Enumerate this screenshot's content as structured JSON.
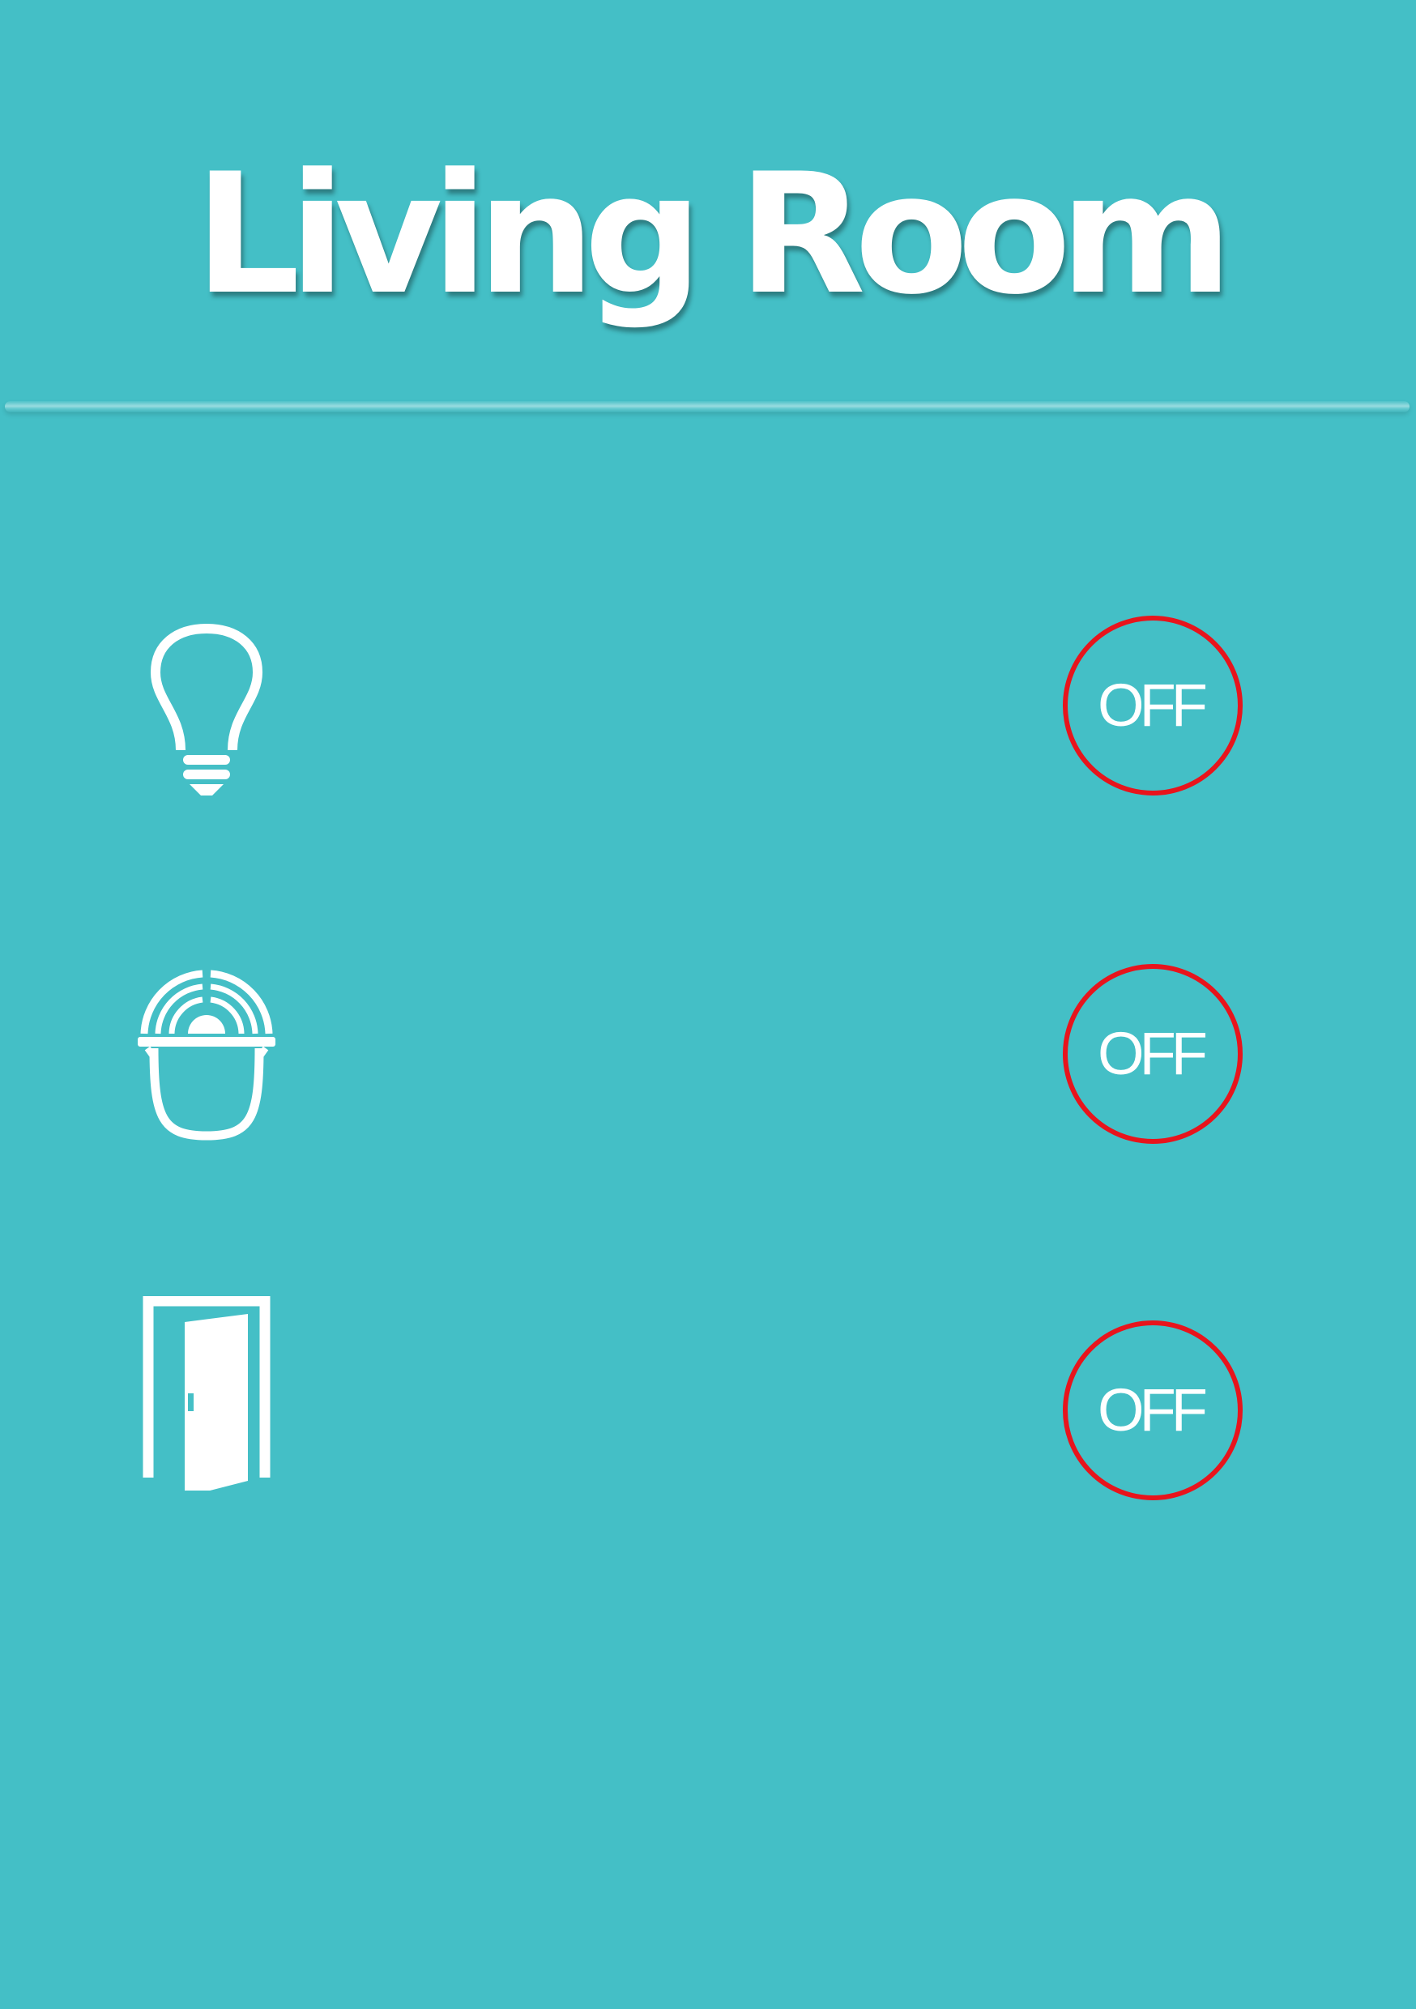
{
  "header": {
    "title": "Living Room"
  },
  "colors": {
    "background": "#44bfc6",
    "icon": "#ffffff",
    "toggle_ring_off": "#e8141c",
    "toggle_text": "#ffffff"
  },
  "devices": [
    {
      "icon": "light-bulb-icon",
      "state_label": "OFF"
    },
    {
      "icon": "alarm-siren-icon",
      "state_label": "OFF"
    },
    {
      "icon": "door-icon",
      "state_label": "OFF"
    }
  ]
}
